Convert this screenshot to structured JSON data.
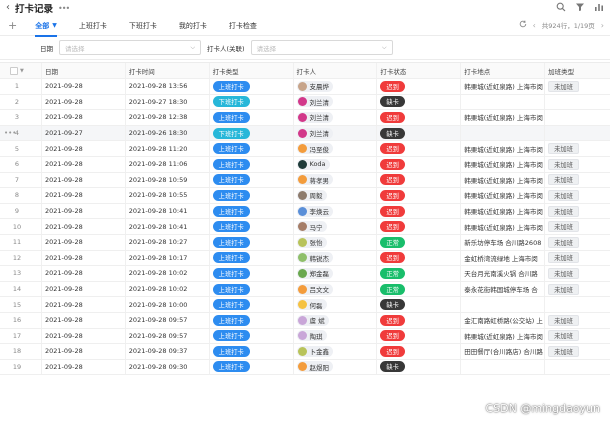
{
  "window": {
    "title": "打卡记录"
  },
  "tabs": [
    {
      "label": "全部",
      "active": true
    },
    {
      "label": "上班打卡",
      "active": false
    },
    {
      "label": "下班打卡",
      "active": false
    },
    {
      "label": "我的打卡",
      "active": false
    },
    {
      "label": "打卡检查",
      "active": false
    }
  ],
  "pagination": "共924行，1/19页",
  "filters": {
    "date_label": "日期",
    "date_placeholder": "请选择",
    "person_label": "打卡人(关联)",
    "person_placeholder": "请选择"
  },
  "columns": [
    "日期",
    "打卡时间",
    "打卡类型",
    "打卡人",
    "打卡状态",
    "打卡地点",
    "加班类型"
  ],
  "colors": {
    "accent": "#1a73e8",
    "type_in": "#2d8cf0",
    "type_out": "#27b7d9",
    "status_late": "#f03b3b",
    "status_missing": "#383838",
    "status_normal": "#19be6b"
  },
  "rows": [
    {
      "num": "1",
      "date": "2021-09-28",
      "time": "2021-09-28 13:56",
      "type": "上班打卡",
      "type_kind": "in",
      "person": "支晨烨",
      "avatar": "#c7a48a",
      "status": "迟到",
      "status_kind": "late",
      "location": "韩栗城(近虹泉路) 上海市闵",
      "ot": "未加班"
    },
    {
      "num": "2",
      "date": "2021-09-28",
      "time": "2021-09-27 18:30",
      "type": "下班打卡",
      "type_kind": "out",
      "person": "刘兰清",
      "avatar": "#d2388a",
      "status": "缺卡",
      "status_kind": "missing",
      "location": "",
      "ot": ""
    },
    {
      "num": "3",
      "date": "2021-09-28",
      "time": "2021-09-28 12:38",
      "type": "上班打卡",
      "type_kind": "in",
      "person": "刘兰清",
      "avatar": "#d2388a",
      "status": "迟到",
      "status_kind": "late",
      "location": "韩栗城(近虹泉路) 上海市闵",
      "ot": ""
    },
    {
      "num": "4",
      "date": "2021-09-27",
      "time": "2021-09-26 18:30",
      "type": "下班打卡",
      "type_kind": "out",
      "person": "刘兰清",
      "avatar": "#d2388a",
      "status": "缺卡",
      "status_kind": "missing",
      "location": "",
      "ot": ""
    },
    {
      "num": "5",
      "date": "2021-09-28",
      "time": "2021-09-28 11:20",
      "type": "上班打卡",
      "type_kind": "in",
      "person": "冯至俊",
      "avatar": "#f39c3c",
      "status": "迟到",
      "status_kind": "late",
      "location": "韩栗城(近虹泉路) 上海市闵",
      "ot": "未加班"
    },
    {
      "num": "6",
      "date": "2021-09-28",
      "time": "2021-09-28 11:06",
      "type": "上班打卡",
      "type_kind": "in",
      "person": "Koda",
      "avatar": "#1f3b3a",
      "status": "迟到",
      "status_kind": "late",
      "location": "韩栗城(近虹泉路) 上海市闵",
      "ot": "未加班"
    },
    {
      "num": "7",
      "date": "2021-09-28",
      "time": "2021-09-28 10:59",
      "type": "上班打卡",
      "type_kind": "in",
      "person": "蒋孝男",
      "avatar": "#f39c3c",
      "status": "迟到",
      "status_kind": "late",
      "location": "韩栗城(近虹泉路) 上海市闵",
      "ot": "未加班"
    },
    {
      "num": "8",
      "date": "2021-09-28",
      "time": "2021-09-28 10:55",
      "type": "上班打卡",
      "type_kind": "in",
      "person": "周毅",
      "avatar": "#8d7b6d",
      "status": "迟到",
      "status_kind": "late",
      "location": "韩栗城(近虹泉路) 上海市闵",
      "ot": "未加班"
    },
    {
      "num": "9",
      "date": "2021-09-28",
      "time": "2021-09-28 10:41",
      "type": "上班打卡",
      "type_kind": "in",
      "person": "李焕云",
      "avatar": "#5a8fd8",
      "status": "迟到",
      "status_kind": "late",
      "location": "韩栗城(近虹泉路) 上海市闵",
      "ot": "未加班"
    },
    {
      "num": "10",
      "date": "2021-09-28",
      "time": "2021-09-28 10:41",
      "type": "上班打卡",
      "type_kind": "in",
      "person": "马宁",
      "avatar": "#a57d67",
      "status": "迟到",
      "status_kind": "late",
      "location": "韩栗城(近虹泉路) 上海市闵",
      "ot": "未加班"
    },
    {
      "num": "11",
      "date": "2021-09-28",
      "time": "2021-09-28 10:27",
      "type": "上班打卡",
      "type_kind": "in",
      "person": "张怡",
      "avatar": "#b8c35a",
      "status": "正常",
      "status_kind": "normal",
      "location": "新乐坊停车场 合川路2608",
      "ot": "未加班"
    },
    {
      "num": "12",
      "date": "2021-09-28",
      "time": "2021-09-28 10:17",
      "type": "上班打卡",
      "type_kind": "in",
      "person": "韩锐杰",
      "avatar": "#8fbf6a",
      "status": "迟到",
      "status_kind": "late",
      "location": "金虹桥湾流绿地 上海市闵",
      "ot": "未加班"
    },
    {
      "num": "13",
      "date": "2021-09-28",
      "time": "2021-09-28 10:02",
      "type": "上班打卡",
      "type_kind": "in",
      "person": "郑金磊",
      "avatar": "#6aa84f",
      "status": "正常",
      "status_kind": "normal",
      "location": "天台月光南溪火锅 合川路",
      "ot": "未加班"
    },
    {
      "num": "14",
      "date": "2021-09-28",
      "time": "2021-09-28 10:02",
      "type": "上班打卡",
      "type_kind": "in",
      "person": "吕文文",
      "avatar": "#f39c3c",
      "status": "正常",
      "status_kind": "normal",
      "location": "泰永花街韩国城停车场 合",
      "ot": "未加班"
    },
    {
      "num": "15",
      "date": "2021-09-28",
      "time": "2021-09-28 10:00",
      "type": "上班打卡",
      "type_kind": "in",
      "person": "何磊",
      "avatar": "#f5c242",
      "status": "缺卡",
      "status_kind": "missing",
      "location": "",
      "ot": ""
    },
    {
      "num": "16",
      "date": "2021-09-28",
      "time": "2021-09-28 09:57",
      "type": "上班打卡",
      "type_kind": "in",
      "person": "虞 斌",
      "avatar": "#c9a6d8",
      "status": "迟到",
      "status_kind": "late",
      "location": "金汇南路虹桥路(公交站) 上",
      "ot": "未加班"
    },
    {
      "num": "17",
      "date": "2021-09-28",
      "time": "2021-09-28 09:57",
      "type": "上班打卡",
      "type_kind": "in",
      "person": "陶琪",
      "avatar": "#c9a6d8",
      "status": "迟到",
      "status_kind": "late",
      "location": "韩栗城(近虹泉路) 上海市闵",
      "ot": "未加班"
    },
    {
      "num": "18",
      "date": "2021-09-28",
      "time": "2021-09-28 09:37",
      "type": "上班打卡",
      "type_kind": "in",
      "person": "卜金鑫",
      "avatar": "#b8c35a",
      "status": "迟到",
      "status_kind": "late",
      "location": "田田餐厅(合川路店) 合川路",
      "ot": "未加班"
    },
    {
      "num": "19",
      "date": "2021-09-28",
      "time": "2021-09-28 09:30",
      "type": "上班打卡",
      "type_kind": "in",
      "person": "赵煜阳",
      "avatar": "#f39c3c",
      "status": "缺卡",
      "status_kind": "missing",
      "location": "",
      "ot": ""
    }
  ],
  "watermark": "CSDN @mingdaoyun"
}
